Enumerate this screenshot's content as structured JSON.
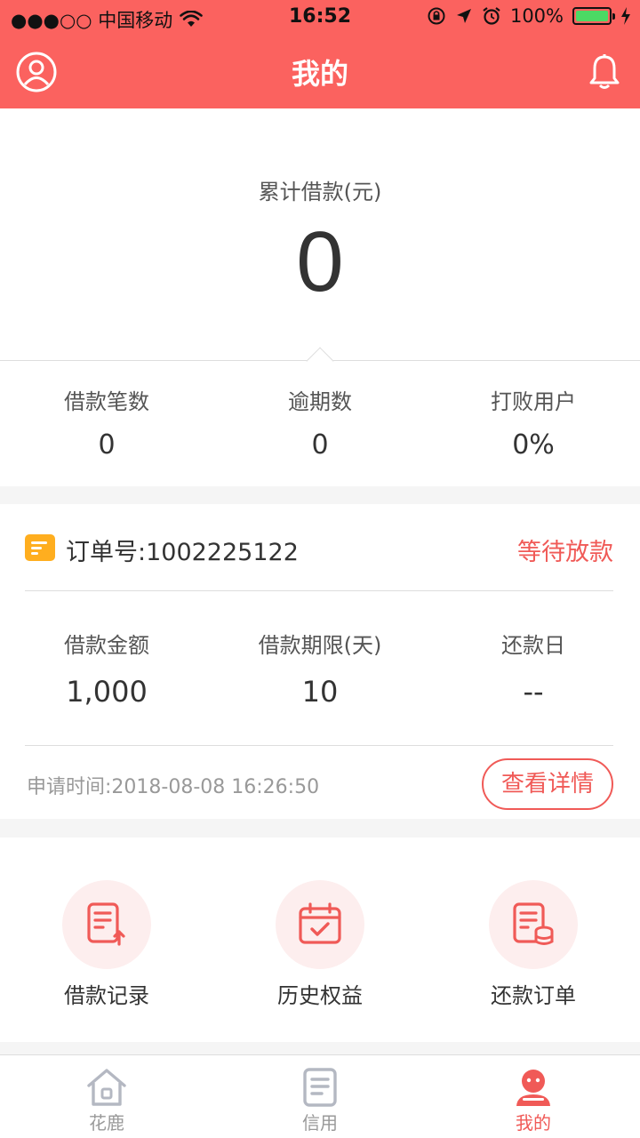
{
  "status_bar": {
    "carrier": "●●●○○ 中国移动",
    "time": "16:52",
    "battery": "100%",
    "battery_level": 1.0
  },
  "nav": {
    "title": "我的"
  },
  "summary": {
    "label": "累计借款(元)",
    "value": "0"
  },
  "stats": [
    {
      "label": "借款笔数",
      "value": "0"
    },
    {
      "label": "逾期数",
      "value": "0"
    },
    {
      "label": "打败用户",
      "value": "0%"
    }
  ],
  "order": {
    "number": "订单号:1002225122",
    "status": "等待放款",
    "details": [
      {
        "label": "借款金额",
        "value": "1,000"
      },
      {
        "label": "借款期限(天)",
        "value": "10"
      },
      {
        "label": "还款日",
        "value": "--"
      }
    ],
    "apply_time": "申请时间:2018-08-08 16:26:50",
    "detail_button": "查看详情"
  },
  "quick_actions": [
    {
      "label": "借款记录",
      "icon": "loan-record-icon"
    },
    {
      "label": "历史权益",
      "icon": "calendar-check-icon"
    },
    {
      "label": "还款订单",
      "icon": "repay-order-icon"
    }
  ],
  "tabs": [
    {
      "label": "花鹿",
      "icon": "home-icon",
      "active": false
    },
    {
      "label": "信用",
      "icon": "document-icon",
      "active": false
    },
    {
      "label": "我的",
      "icon": "user-face-icon",
      "active": true
    }
  ],
  "colors": {
    "brand": "#fb625f",
    "accent_text": "#f05a57",
    "order_icon": "#ffae1f"
  }
}
